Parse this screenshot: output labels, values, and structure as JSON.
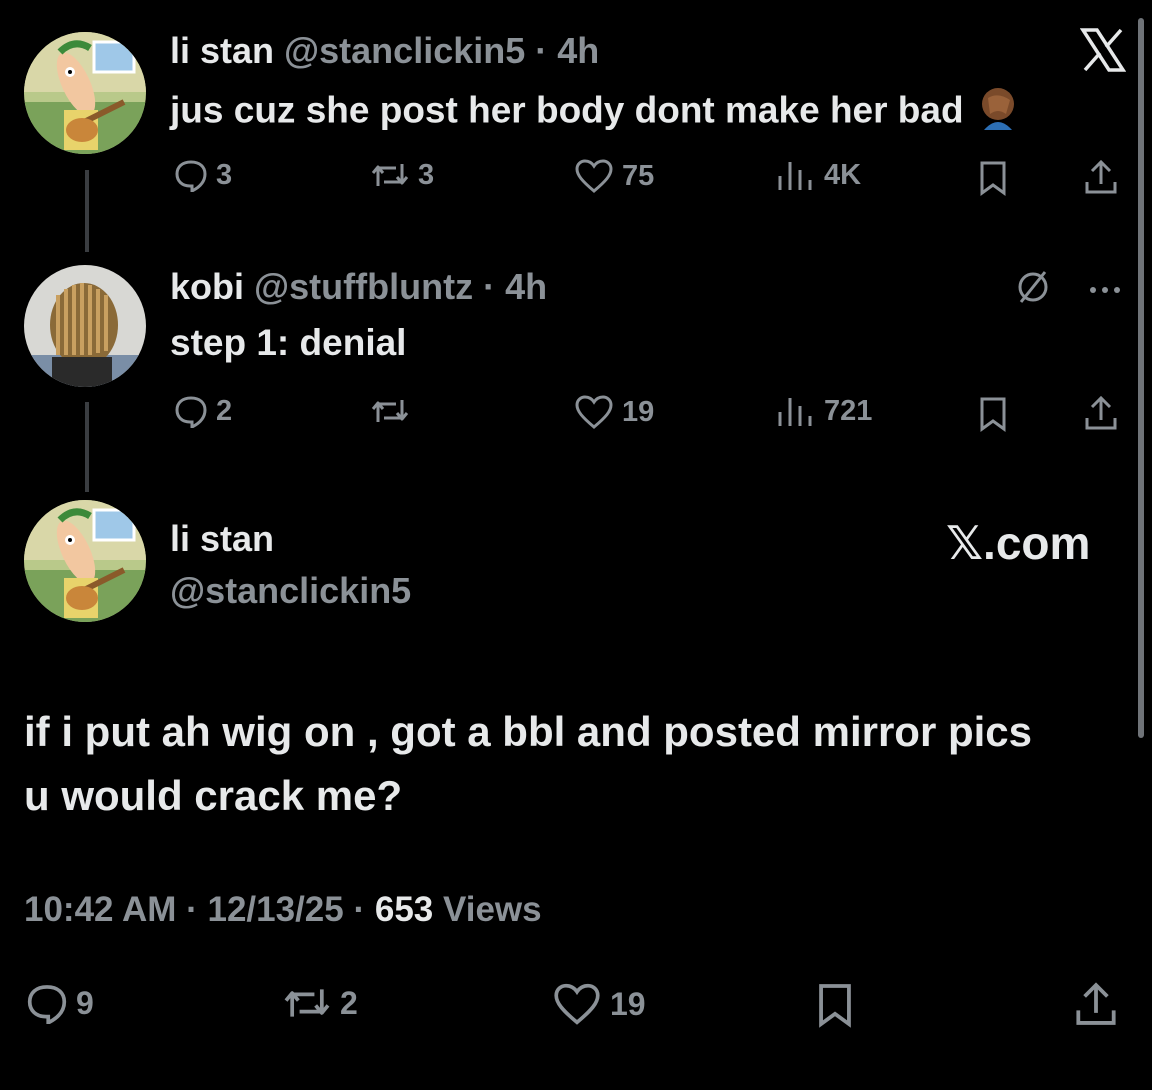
{
  "tweets": [
    {
      "display_name": "li stan",
      "handle": "@stanclickin5",
      "time": "· 4h",
      "text": "jus cuz she post her body dont make her bad",
      "emoji": "🤦🏾‍♂️",
      "replies": "3",
      "reposts": "3",
      "likes": "75",
      "views": "4K"
    },
    {
      "display_name": "kobi",
      "handle": "@stuffbluntz",
      "time": "· 4h",
      "text": "step 1: denial",
      "replies": "2",
      "reposts": "",
      "likes": "19",
      "views": "721"
    }
  ],
  "main_tweet": {
    "display_name": "li stan",
    "handle": "@stanclickin5",
    "brand": "𝕏.com",
    "text": "if i put ah wig on , got a bbl and posted mirror pics u would crack me?",
    "time": "10:42 AM",
    "date": "12/13/25",
    "views_count": "653",
    "views_label": "Views",
    "sep": "·",
    "replies": "9",
    "reposts": "2",
    "likes": "19"
  },
  "icons": {
    "x_logo": "x-logo-icon",
    "reply": "reply-icon",
    "repost": "repost-icon",
    "like": "heart-icon",
    "views": "views-icon",
    "bookmark": "bookmark-icon",
    "share": "share-icon",
    "mute": "mute-icon",
    "more": "more-icon"
  },
  "colors": {
    "background": "#000000",
    "text": "#e7e9ea",
    "muted": "#8b9197"
  }
}
